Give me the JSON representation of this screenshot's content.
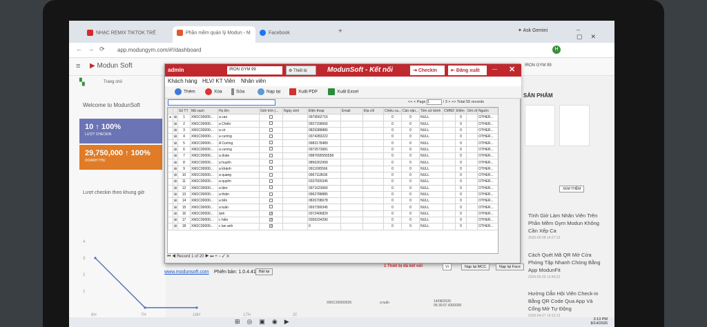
{
  "browser": {
    "tabs": [
      {
        "label": "NHẠC REMIX TIKTOK TRẺ",
        "active": false,
        "color": "#d62a2a"
      },
      {
        "label": "Phần mềm quản lý Modun - M",
        "active": true,
        "color": "#e05a2b"
      },
      {
        "label": "Facebook",
        "active": false,
        "color": "#1877f2"
      }
    ],
    "gemini": "Ask Gemini",
    "url": "app.modungym.com/#!/dashboard",
    "avatar": "H"
  },
  "site": {
    "brand": "Modun Soft",
    "home": "Trang chủ",
    "gym_selector": "IRON GYM 99",
    "stats": "Thống kê",
    "welcome": "Welcome to ModunSoft",
    "cards": [
      {
        "value": "10 ↑ 100%",
        "label": "LƯỢT CHECKIN",
        "color": "#6b74b4"
      },
      {
        "value": "29,750,000 ↑ 100%",
        "label": "DOANH THU",
        "color": "#e07b27"
      }
    ],
    "chart_title": "Lượt checkin theo khung giờ",
    "right_heading": "SẢN PHẨM",
    "view_more": "XEM THÊM",
    "news": [
      {
        "title": "Tính Giờ Làm Nhân Viên Trên Phần Mềm Gym Modun Không Cần Xếp Ca",
        "date": "2026-05-08 14:27:13"
      },
      {
        "title": "Cách Quét Mã QR Mở Cửa Phòng Tập Nhanh Chóng Bằng App ModunFit",
        "date": "2026-05-29 13:45:22"
      },
      {
        "title": "Hướng Dẫn Hội Viên Check-in Bằng QR Code Qua App Và Cổng Mở Tự Động",
        "date": "2026-04-27 14:12:13"
      }
    ],
    "log_row": {
      "code": "XM1C00000026",
      "name": "a tuấn",
      "time": "14/08/2026 06:30:07.4300000"
    }
  },
  "chart_data": {
    "type": "line",
    "title": "Lượt checkin theo khung giờ",
    "x": [
      "6H",
      "7H",
      "16H",
      "17H",
      "20H"
    ],
    "series": [
      {
        "values": [
          3,
          0,
          0,
          null,
          null
        ]
      }
    ],
    "ylim": [
      0,
      4
    ],
    "yticks": [
      1,
      2,
      3,
      4
    ]
  },
  "app": {
    "user": "admin",
    "gym": "IRON GYM 99",
    "device_btn": "Thiết bị",
    "title": "ModunSoft - Kết nối",
    "checkin": "Checkin",
    "logout": "Đăng xuất",
    "menu": [
      "Khách hàng",
      "HLV/ KT Viên",
      "Nhân viên"
    ],
    "toolbar": [
      "Thêm",
      "Xóa",
      "Sửa",
      "Nạp lại",
      "Xuất PDF",
      "Xuất Excel"
    ],
    "pager": {
      "page_label": "Page",
      "page": "1",
      "of": "/ 3",
      "total": "Total 55 records"
    },
    "columns": [
      "Số TT",
      "Mã vạch",
      "Họ tên",
      "Giới tính (...",
      "Ngày sinh",
      "Điện thoại",
      "Email",
      "Địa chỉ",
      "Chiều ca...",
      "Cân nặn...",
      "Tiền sử bệnh",
      "CMND",
      "Điểm",
      "Ghi chú",
      "Nguồn"
    ],
    "rows": [
      [
        "1",
        "XM1C00000...",
        "a cao",
        "",
        "0979562716",
        "0",
        "0",
        "NULL",
        "0",
        "OTHER..."
      ],
      [
        "2",
        "XM1C00000...",
        "a Chiến",
        "",
        "0927158666",
        "0",
        "0",
        "NULL",
        "0",
        "OTHER..."
      ],
      [
        "3",
        "XM1C00000...",
        "a cò",
        "",
        "0829388886",
        "0",
        "0",
        "NULL",
        "0",
        "OTHER..."
      ],
      [
        "4",
        "XM1C00000...",
        "a cường",
        "",
        "0374283222",
        "0",
        "0",
        "NULL",
        "0",
        "OTHER..."
      ],
      [
        "5",
        "XM1C00000...",
        "A Cường",
        "",
        "0983178489",
        "0",
        "0",
        "NULL",
        "0",
        "OTHER..."
      ],
      [
        "6",
        "XM1C00000...",
        "a cương",
        "",
        "0972573681",
        "0",
        "0",
        "NULL",
        "0",
        "OTHER..."
      ],
      [
        "7",
        "XM1C00000...",
        "a đoàn",
        "",
        "0987695555558",
        "0",
        "0",
        "NULL",
        "0",
        "OTHER..."
      ],
      [
        "8",
        "XM1C00000...",
        "a huyến",
        "",
        "0856262999",
        "0",
        "0",
        "NULL",
        "0",
        "OTHER..."
      ],
      [
        "9",
        "XM1C00000...",
        "a khánh",
        "",
        "0911095566",
        "0",
        "0",
        "NULL",
        "0",
        "OTHER..."
      ],
      [
        "10",
        "XM1C00000...",
        "a quang",
        "",
        "0967118636",
        "0",
        "0",
        "NULL",
        "0",
        "OTHER..."
      ],
      [
        "11",
        "XM1C00000...",
        "a quyền",
        "",
        "0337555345",
        "0",
        "0",
        "NULL",
        "0",
        "OTHER..."
      ],
      [
        "12",
        "XM1C00000...",
        "a tâm",
        "",
        "0971623666",
        "0",
        "0",
        "NULL",
        "0",
        "OTHER..."
      ],
      [
        "13",
        "XM1C00000...",
        "a thiện",
        "",
        "0962788885",
        "0",
        "0",
        "NULL",
        "0",
        "OTHER..."
      ],
      [
        "14",
        "XM1C00000...",
        "a tiến",
        "",
        "0826708678",
        "0",
        "0",
        "NULL",
        "0",
        "OTHER..."
      ],
      [
        "15",
        "XM1C00000...",
        "a tuấn",
        "",
        "0937399345",
        "0",
        "0",
        "NULL",
        "0",
        "OTHER..."
      ],
      [
        "16",
        "XM1C00000...",
        "ánh",
        "✓",
        "0372406829",
        "0",
        "0",
        "NULL",
        "0",
        "OTHER..."
      ],
      [
        "17",
        "XM1C00000...",
        "c hiền",
        "✓",
        "0356234290",
        "0",
        "0",
        "NULL",
        "0",
        "OTHER..."
      ],
      [
        "18",
        "XM1C00000...",
        "c lan anh",
        "✓",
        "0",
        "0",
        "0",
        "NULL",
        "0",
        "OTHER..."
      ]
    ],
    "record_nav": "Record 1 of 20",
    "site_link": "www.modunsoft.com",
    "version": "Phiên bản: 1.0.4.41",
    "update_btn": "Bật lại",
    "device_status": "1 Thiết bị đã kết nối",
    "lang": "Vi",
    "reload_mcc": "Nạp lại MCC",
    "reload_face": "Nạp lại Face"
  },
  "taskbar": {
    "time": "3:13 PM",
    "date": "8/14/2026"
  },
  "colors": {
    "brand_red": "#c0282d",
    "purple": "#6b74b4",
    "orange": "#e07b27"
  }
}
